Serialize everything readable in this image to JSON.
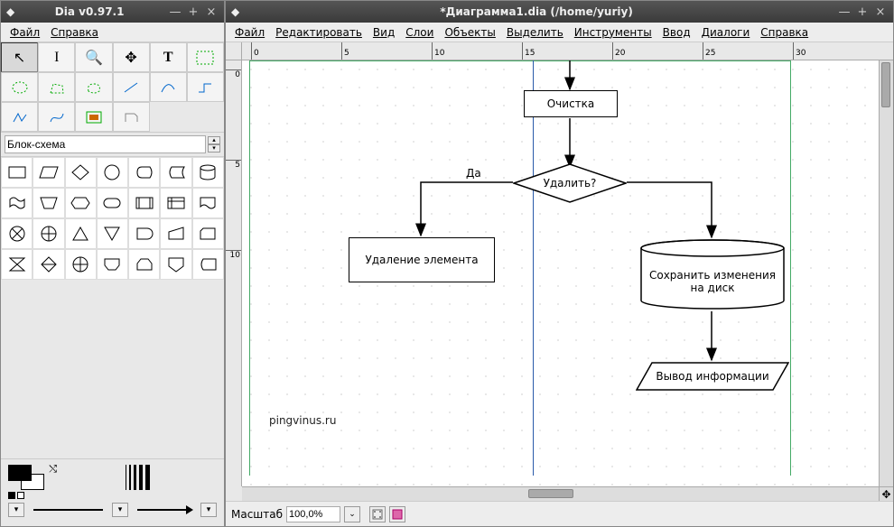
{
  "toolbox": {
    "title": "Dia v0.97.1",
    "menu": [
      "Файл",
      "Справка"
    ],
    "shape_sheet": "Блок-схема",
    "tools": [
      {
        "name": "pointer",
        "glyph": "↖"
      },
      {
        "name": "text-cursor",
        "glyph": "I"
      },
      {
        "name": "magnify",
        "glyph": "🔍"
      },
      {
        "name": "scroll",
        "glyph": "✥"
      },
      {
        "name": "text",
        "glyph": "T"
      },
      {
        "name": "box",
        "glyph": "▭"
      },
      {
        "name": "ellipse",
        "glyph": "◯"
      },
      {
        "name": "polygon",
        "glyph": "⬠"
      },
      {
        "name": "beziergon",
        "glyph": "◇"
      },
      {
        "name": "line",
        "glyph": "／"
      },
      {
        "name": "arc",
        "glyph": "⤵"
      },
      {
        "name": "zigzag",
        "glyph": "↯"
      },
      {
        "name": "polyline",
        "glyph": "∿"
      },
      {
        "name": "bezier",
        "glyph": "∫"
      },
      {
        "name": "image",
        "glyph": "▦"
      },
      {
        "name": "outline",
        "glyph": "◫"
      }
    ]
  },
  "canvasWin": {
    "title": "*Диаграмма1.dia (/home/yuriy)",
    "menu": [
      "Файл",
      "Редактировать",
      "Вид",
      "Слои",
      "Объекты",
      "Выделить",
      "Инструменты",
      "Ввод",
      "Диалоги",
      "Справка"
    ],
    "zoom_label": "Масштаб",
    "zoom_value": "100,0%",
    "ruler_h": [
      "0",
      "5",
      "10",
      "15",
      "20",
      "25",
      "30"
    ],
    "ruler_v": [
      "0",
      "5",
      "10"
    ],
    "watermark": "pingvinus.ru"
  },
  "diagram": {
    "ochistka": "Очистка",
    "udalit": "Удалить?",
    "da": "Да",
    "udalenie": "Удаление элемента",
    "sohranit": "Сохранить изменения на диск",
    "vyvod": "Вывод информации"
  }
}
